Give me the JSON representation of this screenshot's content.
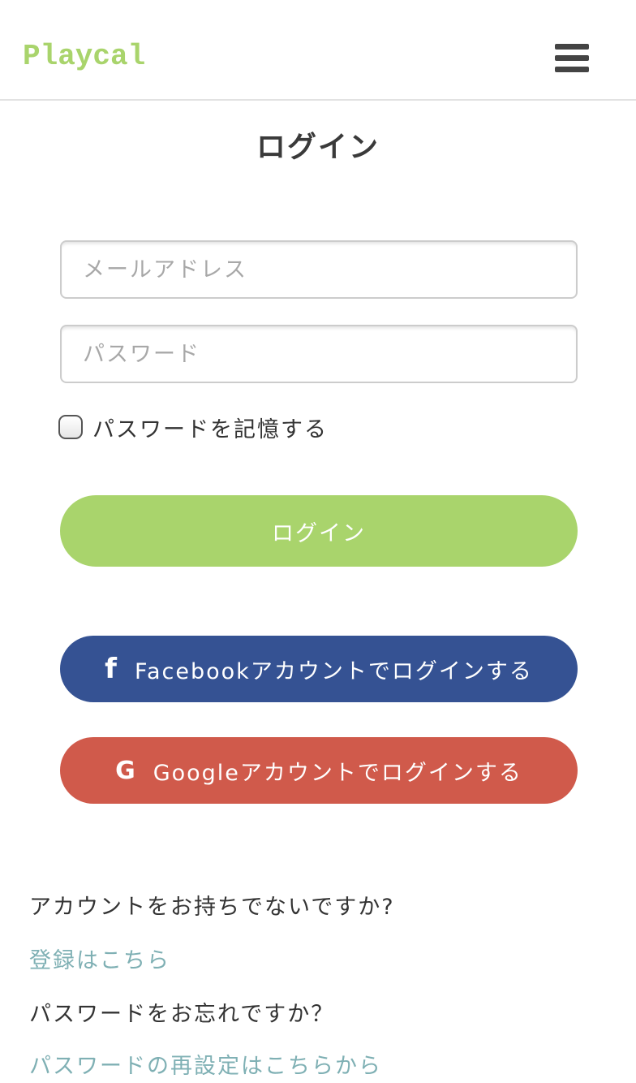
{
  "header": {
    "logo": "Playcal",
    "menu_icon": "hamburger-menu-icon"
  },
  "page": {
    "title": "ログイン"
  },
  "form": {
    "email_placeholder": "メールアドレス",
    "email_value": "",
    "password_placeholder": "パスワード",
    "password_value": "",
    "remember_label": "パスワードを記憶する",
    "remember_checked": false,
    "login_button": "ログイン"
  },
  "social": {
    "facebook_label": "Facebookアカウントでログインする",
    "facebook_icon": "f",
    "google_label": "Googleアカウントでログインする",
    "google_icon": "G"
  },
  "footer": {
    "no_account_text": "アカウントをお持ちでないですか?",
    "register_link": "登録はこちら",
    "forgot_text": "パスワードをお忘れですか？",
    "reset_link": "パスワードの再設定はこちらから"
  },
  "colors": {
    "accent_green": "#a9d46c",
    "facebook_blue": "#355293",
    "google_red": "#d05a4b",
    "link_teal": "#7fb0b4"
  }
}
